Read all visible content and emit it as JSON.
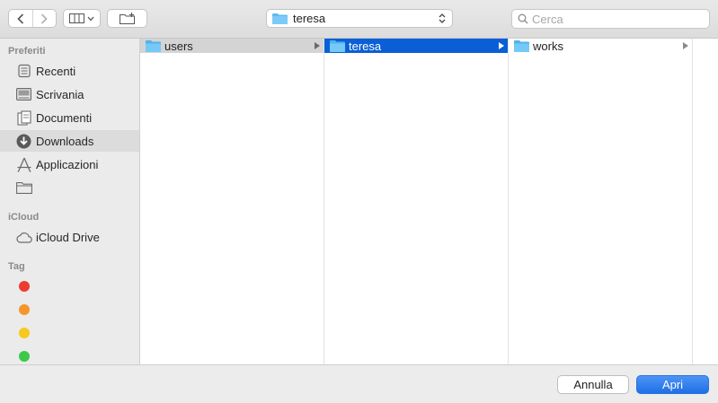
{
  "toolbar": {
    "back_icon": "chevron-left-icon",
    "forward_icon": "chevron-right-icon",
    "view_icon": "column-view-icon",
    "new_folder_icon": "new-folder-icon",
    "path_value": "teresa",
    "search_placeholder": "Cerca"
  },
  "sidebar": {
    "favorites_title": "Preferiti",
    "favorites": [
      {
        "label": "Recenti",
        "icon": "clock-icon"
      },
      {
        "label": "Scrivania",
        "icon": "desktop-icon"
      },
      {
        "label": "Documenti",
        "icon": "document-icon"
      },
      {
        "label": "Downloads",
        "icon": "download-icon",
        "selected": true
      },
      {
        "label": "Applicazioni",
        "icon": "applications-icon"
      },
      {
        "label": "",
        "icon": "folder-icon"
      }
    ],
    "icloud_title": "iCloud",
    "icloud": [
      {
        "label": "iCloud Drive",
        "icon": "cloud-icon"
      }
    ],
    "tags_title": "Tag",
    "tags": [
      {
        "color": "#ee3b30"
      },
      {
        "color": "#f5962b"
      },
      {
        "color": "#f7c91c"
      },
      {
        "color": "#3cc94a"
      }
    ]
  },
  "browser": {
    "columns": [
      {
        "items": [
          {
            "name": "users",
            "state": "path"
          }
        ]
      },
      {
        "items": [
          {
            "name": "teresa",
            "state": "active"
          }
        ]
      },
      {
        "items": [
          {
            "name": "works",
            "state": "normal"
          }
        ]
      }
    ]
  },
  "footer": {
    "cancel_label": "Annulla",
    "open_label": "Apri"
  },
  "colors": {
    "accent": "#0b5fd6",
    "folder": "#5bbcf2"
  }
}
